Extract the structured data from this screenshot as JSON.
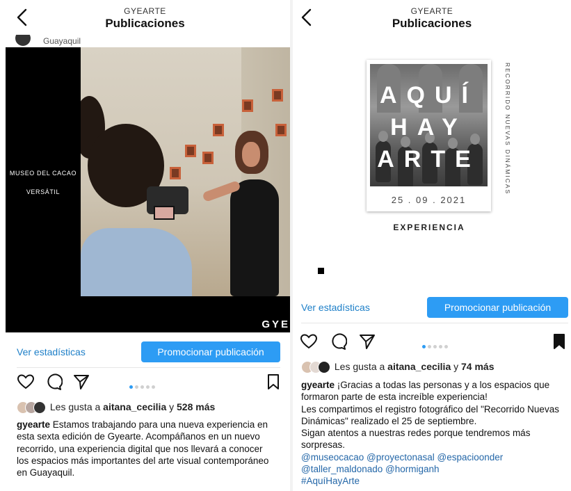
{
  "left": {
    "header": {
      "account": "GYEARTE",
      "title": "Publicaciones"
    },
    "location_partial": "Guayaquil",
    "image": {
      "side_text_1": "MUSEO DEL CACAO",
      "side_text_2": "VERSÁTIL",
      "watermark": "GYE"
    },
    "stats_label": "Ver estadísticas",
    "promote_label": "Promocionar publicación",
    "carousel": {
      "total": 5,
      "active": 1
    },
    "likes": {
      "prefix": "Les gusta a ",
      "user": "aitana_cecilia",
      "middle": " y ",
      "count": "528 más"
    },
    "caption": {
      "user": "gyearte",
      "text": " Estamos trabajando para una nueva experiencia en esta sexta edición de Gyearte. Acompáñanos en un nuevo recorrido, una experiencia digital que nos llevará a conocer los espacios más importantes del arte visual contemporáneo en Guayaquil."
    }
  },
  "right": {
    "header": {
      "account": "GYEARTE",
      "title": "Publicaciones"
    },
    "image": {
      "big_line_1": "AQUÍ",
      "big_line_2": "HAY",
      "big_line_3": "ARTE",
      "date": "25 . 09 . 2021",
      "vertical": "RECORRIDO NUEVAS DINÁMICAS",
      "label": "EXPERIENCIA"
    },
    "stats_label": "Ver estadísticas",
    "promote_label": "Promocionar publicación",
    "carousel": {
      "total": 5,
      "active": 1
    },
    "likes": {
      "prefix": "Les gusta a ",
      "user": "aitana_cecilia",
      "middle": " y ",
      "count": "74 más"
    },
    "caption": {
      "user": "gyearte",
      "line1": " ¡Gracias a todas las personas y a los espacios que formaron parte de esta increíble experiencia!",
      "line2": "Les compartimos el registro fotográfico del \"Recorrido Nuevas Dinámicas\" realizado el 25 de septiembre.",
      "line3": "Sigan atentos a nuestras redes porque tendremos más sorpresas.",
      "tags": "@museocacao @proyectonasal @espacioonder @taller_maldonado @hormiganh",
      "hashtag": "#AquíHayArte"
    }
  },
  "colors": {
    "accent": "#2d9cf4",
    "link": "#1d7fc8",
    "tag": "#2467a8"
  }
}
